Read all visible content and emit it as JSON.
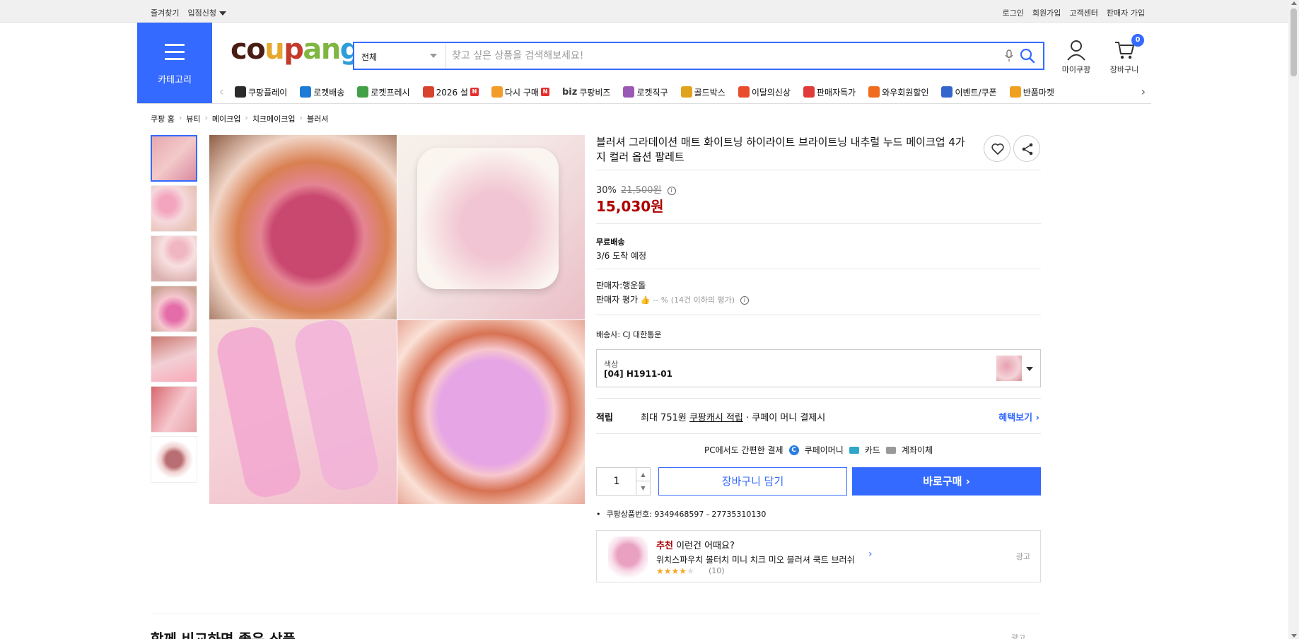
{
  "topbar": {
    "left": [
      "즐겨찾기",
      "입점신청"
    ],
    "right": [
      "로그인",
      "회원가입",
      "고객센터",
      "판매자 가입"
    ]
  },
  "header": {
    "category_label": "카테고리",
    "logo": {
      "p1": "co",
      "p2": "u",
      "p3": "p",
      "p4": "an",
      "p5": "g"
    },
    "search_scope": "전체",
    "search_placeholder": "찾고 싶은 상품을 검색해보세요!",
    "mycoupang_label": "마이쿠팡",
    "cart_label": "장바구니",
    "cart_count": "0"
  },
  "nav": {
    "items": [
      {
        "label": "쿠팡플레이",
        "color": "#2b2b2b"
      },
      {
        "label": "로켓배송",
        "color": "#1c7cd5"
      },
      {
        "label": "로켓프레시",
        "color": "#43a047"
      },
      {
        "label": "2026 설",
        "color": "#d8432d",
        "badge": "N"
      },
      {
        "label": "다시 구매",
        "color": "#f39c2a",
        "badge": "N"
      },
      {
        "label": "쿠팡비즈",
        "color": "#3a3a3a",
        "prefix": "biz"
      },
      {
        "label": "로켓직구",
        "color": "#9b59b6"
      },
      {
        "label": "골드박스",
        "color": "#e0a31b"
      },
      {
        "label": "이달의신상",
        "color": "#e94e2c"
      },
      {
        "label": "판매자특가",
        "color": "#e03a3a"
      },
      {
        "label": "와우회원할인",
        "color": "#f06b1e"
      },
      {
        "label": "이벤트/쿠폰",
        "color": "#3366cc"
      },
      {
        "label": "반품마켓",
        "color": "#f0a020"
      }
    ]
  },
  "breadcrumb": [
    "쿠팡 홈",
    "뷰티",
    "메이크업",
    "치크메이크업",
    "블러셔"
  ],
  "product": {
    "title": "블러셔 그라데이션 매트 화이트닝 하이라이트 브라이트닝 내추럴 누드 메이크업 4가지 컬러 옵션 팔레트",
    "discount": "30%",
    "original_price": "21,500원",
    "price": "15,030원",
    "shipping_title": "무료배송",
    "delivery": "3/6 도착 예정",
    "seller": "판매자:행운돌",
    "seller_rating_label": "판매자 평가",
    "seller_rating": "-- % (14건 이하의 평가)",
    "carrier": "배송사: CJ 대한통운",
    "option_label": "색상",
    "option_value": "[04] H1911-01",
    "reward_label": "적립",
    "reward_prefix": "최대 751원",
    "reward_link": "쿠팡캐시 적립",
    "reward_suffix": "· 쿠페이 머니 결제시",
    "reward_more": "혜택보기",
    "pay_title": "PC에서도 간편한 결제",
    "pay_options": [
      "쿠페이머니",
      "카드",
      "계좌이체"
    ],
    "quantity": "1",
    "add_to_cart": "장바구니 담기",
    "buy_now": "바로구매",
    "product_id": "쿠팡상품번호: 9349468597 - 27735310130"
  },
  "recommendation": {
    "tag": "추천",
    "headline": "이런건 어때요?",
    "name": "위치스파우치 볼터치 미니 치크 미오 블러셔 쿡트 브러쉬",
    "rating": 4.5,
    "count": "(10)",
    "ad_label": "광고"
  },
  "section": {
    "title": "함께 비교하면 좋은 상품",
    "ad_label": "광고"
  }
}
